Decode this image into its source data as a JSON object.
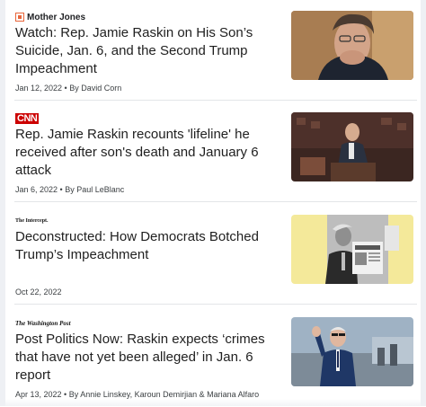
{
  "articles": [
    {
      "source": "Mother Jones",
      "title": "Watch: Rep. Jamie Raskin on His Son’s Suicide, Jan. 6, and the Second Trump Impeachment",
      "meta": "Jan 12, 2022 • By David Corn",
      "thumbnail_icon": "portrait-photo-icon"
    },
    {
      "source": "CNN",
      "title": "Rep. Jamie Raskin recounts 'lifeline' he received after son's death and January 6 attack",
      "meta": "Jan 6, 2022 • By Paul LeBlanc",
      "thumbnail_icon": "senate-speech-photo-icon"
    },
    {
      "source": "The Intercept.",
      "title": "Deconstructed: How Democrats Botched Trump’s Impeachment",
      "meta": "Oct 22, 2022",
      "thumbnail_icon": "newspaper-photo-icon"
    },
    {
      "source": "The Washington Post",
      "title": "Post Politics Now: Raskin expects ‘crimes that have not yet been alleged’ in Jan. 6 report",
      "meta": "Apr 13, 2022 • By Annie Linskey, Karoun Demirjian & Mariana Alfaro",
      "thumbnail_icon": "president-wave-photo-icon"
    }
  ],
  "colors": {
    "mother_jones_orange": "#e8663b",
    "cnn_red": "#cc0000",
    "intercept_yellow": "#f4e99a",
    "divider": "#e3e5e8"
  }
}
